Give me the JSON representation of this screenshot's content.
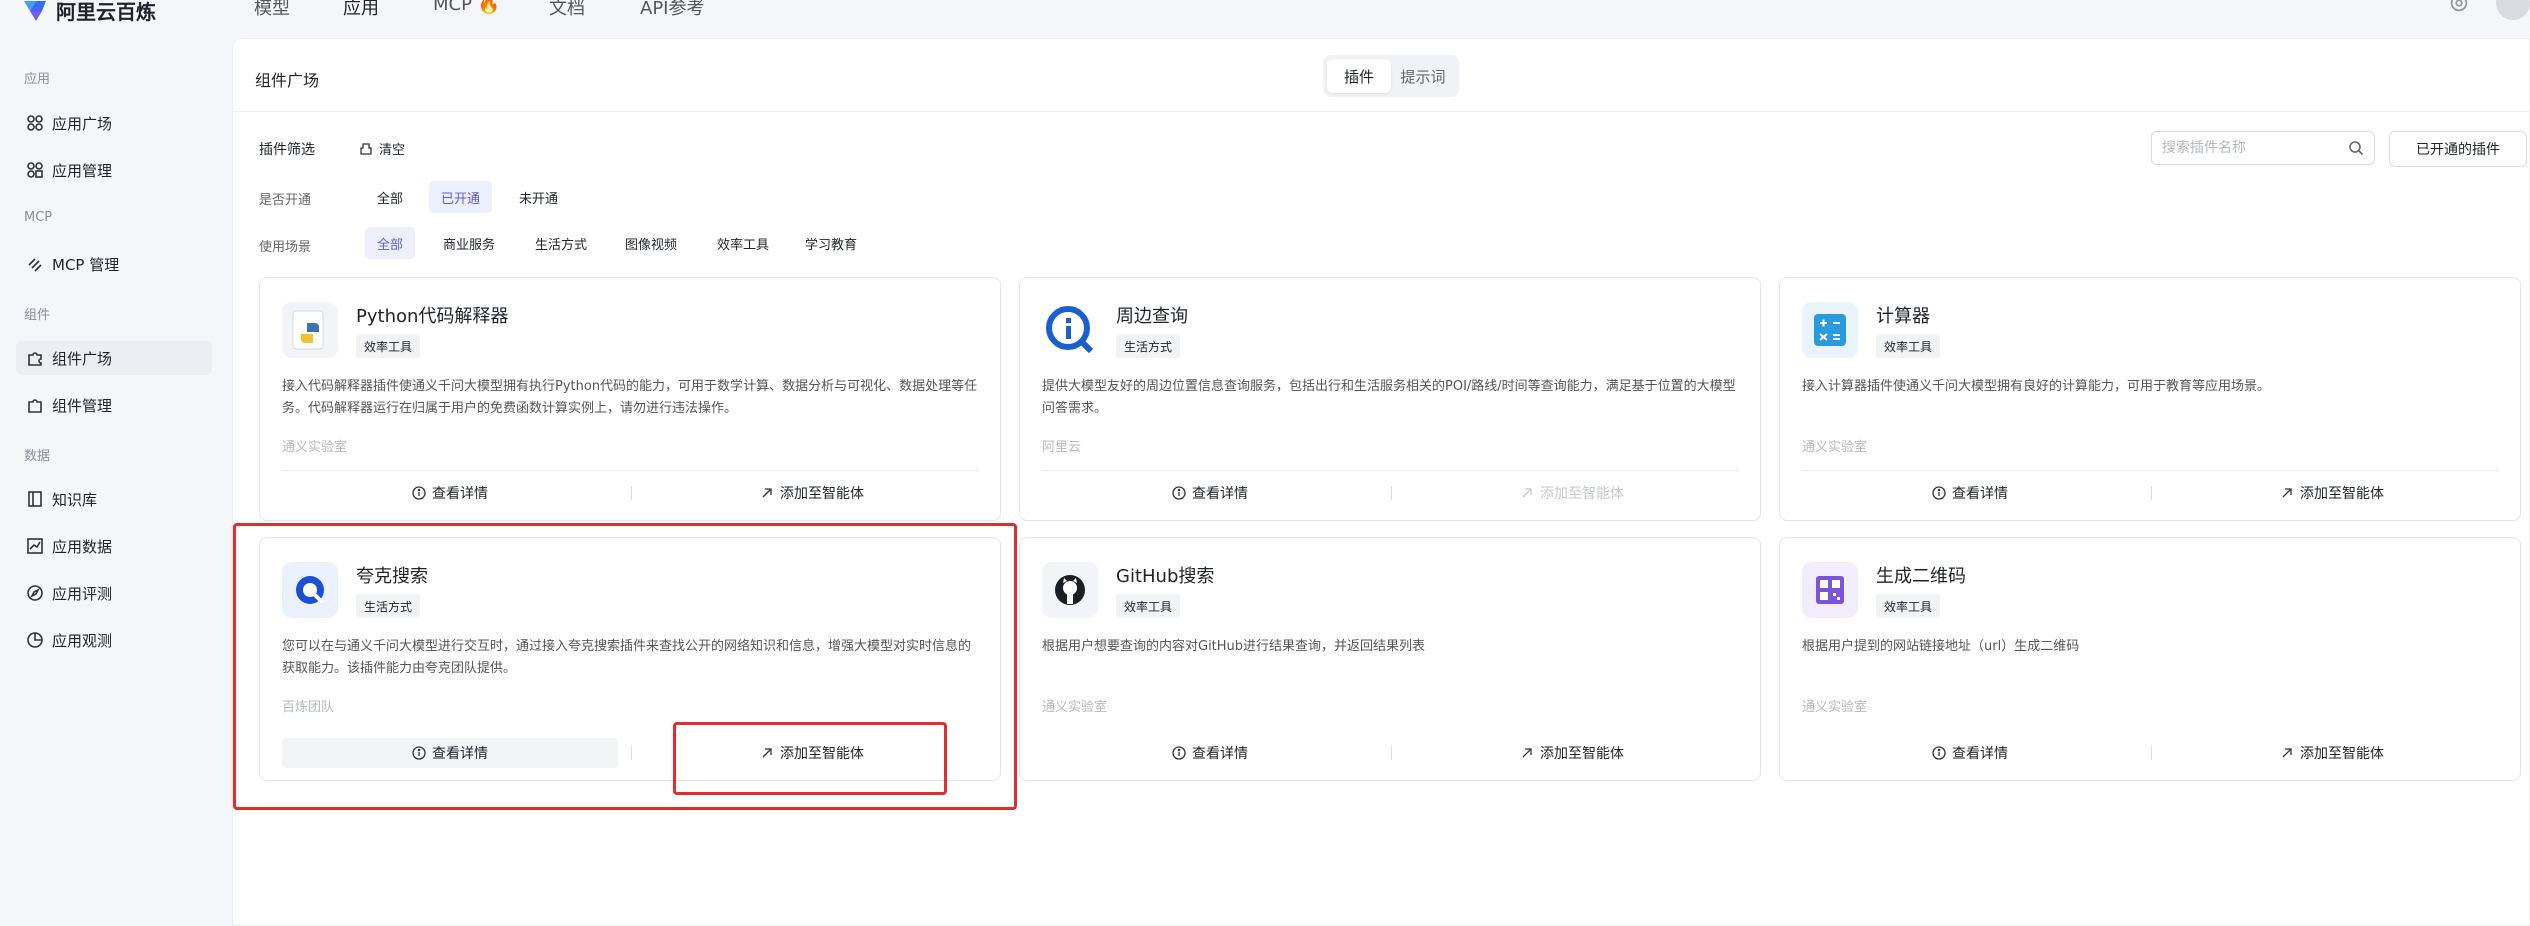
{
  "topnav": {
    "brand": "阿里云百炼",
    "items": [
      "模型",
      "应用",
      "MCP 🔥",
      "文档",
      "API参考"
    ],
    "active": "应用"
  },
  "sidebar": {
    "groups": [
      {
        "label": "应用",
        "items": [
          {
            "label": "应用广场",
            "icon": "apps-icon"
          },
          {
            "label": "应用管理",
            "icon": "apps-manage-icon"
          }
        ]
      },
      {
        "label": "MCP",
        "items": [
          {
            "label": "MCP 管理",
            "icon": "mcp-icon"
          }
        ]
      },
      {
        "label": "组件",
        "items": [
          {
            "label": "组件广场",
            "icon": "puzzle-icon",
            "active": true
          },
          {
            "label": "组件管理",
            "icon": "puzzle-manage-icon"
          }
        ]
      },
      {
        "label": "数据",
        "items": [
          {
            "label": "知识库",
            "icon": "book-icon"
          },
          {
            "label": "应用数据",
            "icon": "chart-icon"
          },
          {
            "label": "应用评测",
            "icon": "compass-icon"
          },
          {
            "label": "应用观测",
            "icon": "pie-icon"
          }
        ]
      }
    ]
  },
  "main": {
    "title": "组件广场",
    "tabs": [
      {
        "label": "插件",
        "active": true
      },
      {
        "label": "提示词",
        "active": false
      }
    ],
    "filter_title": "插件筛选",
    "clear_label": "清空",
    "search": {
      "placeholder": "搜索插件名称",
      "value": ""
    },
    "opened_button": "已开通的插件",
    "rows": [
      {
        "label": "是否开通",
        "chips": [
          "全部",
          "已开通",
          "未开通"
        ],
        "selected": "已开通"
      },
      {
        "label": "使用场景",
        "chips": [
          "全部",
          "商业服务",
          "生活方式",
          "图像视频",
          "效率工具",
          "学习教育"
        ],
        "selected": "全部"
      }
    ]
  },
  "cards": [
    {
      "title": "Python代码解释器",
      "tag": "效率工具",
      "icon": "python-icon",
      "desc": "接入代码解释器插件使通义千问大模型拥有执行Python代码的能力，可用于数学计算、数据分析与可视化、数据处理等任务。代码解释器运行在归属于用户的免费函数计算实例上，请勿进行违法操作。",
      "source": "通义实验室",
      "detail": "查看详情",
      "add": "添加至智能体",
      "add_disabled": false
    },
    {
      "title": "周边查询",
      "tag": "生活方式",
      "icon": "location-search-icon",
      "desc": "提供大模型友好的周边位置信息查询服务，包括出行和生活服务相关的POI/路线/时间等查询能力，满足基于位置的大模型问答需求。",
      "source": "阿里云",
      "detail": "查看详情",
      "add": "添加至智能体",
      "add_disabled": true
    },
    {
      "title": "计算器",
      "tag": "效率工具",
      "icon": "calculator-icon",
      "desc": "接入计算器插件使通义千问大模型拥有良好的计算能力，可用于教育等应用场景。",
      "source": "通义实验室",
      "detail": "查看详情",
      "add": "添加至智能体",
      "add_disabled": false
    },
    {
      "title": "夸克搜索",
      "tag": "生活方式",
      "icon": "quark-icon",
      "desc": "您可以在与通义千问大模型进行交互时，通过接入夸克搜索插件来查找公开的网络知识和信息，增强大模型对实时信息的获取能力。该插件能力由夸克团队提供。",
      "source": "百炼团队",
      "detail": "查看详情",
      "add": "添加至智能体",
      "add_disabled": false
    },
    {
      "title": "GitHub搜索",
      "tag": "效率工具",
      "icon": "github-icon",
      "desc": "根据用户想要查询的内容对GitHub进行结果查询，并返回结果列表",
      "source": "通义实验室",
      "detail": "查看详情",
      "add": "添加至智能体",
      "add_disabled": false
    },
    {
      "title": "生成二维码",
      "tag": "效率工具",
      "icon": "qrcode-icon",
      "desc": "根据用户提到的网站链接地址（url）生成二维码",
      "source": "通义实验室",
      "detail": "查看详情",
      "add": "添加至智能体",
      "add_disabled": false
    }
  ],
  "colors": {
    "accent": "#5b5fd6",
    "annotation": "#e02d2d"
  }
}
